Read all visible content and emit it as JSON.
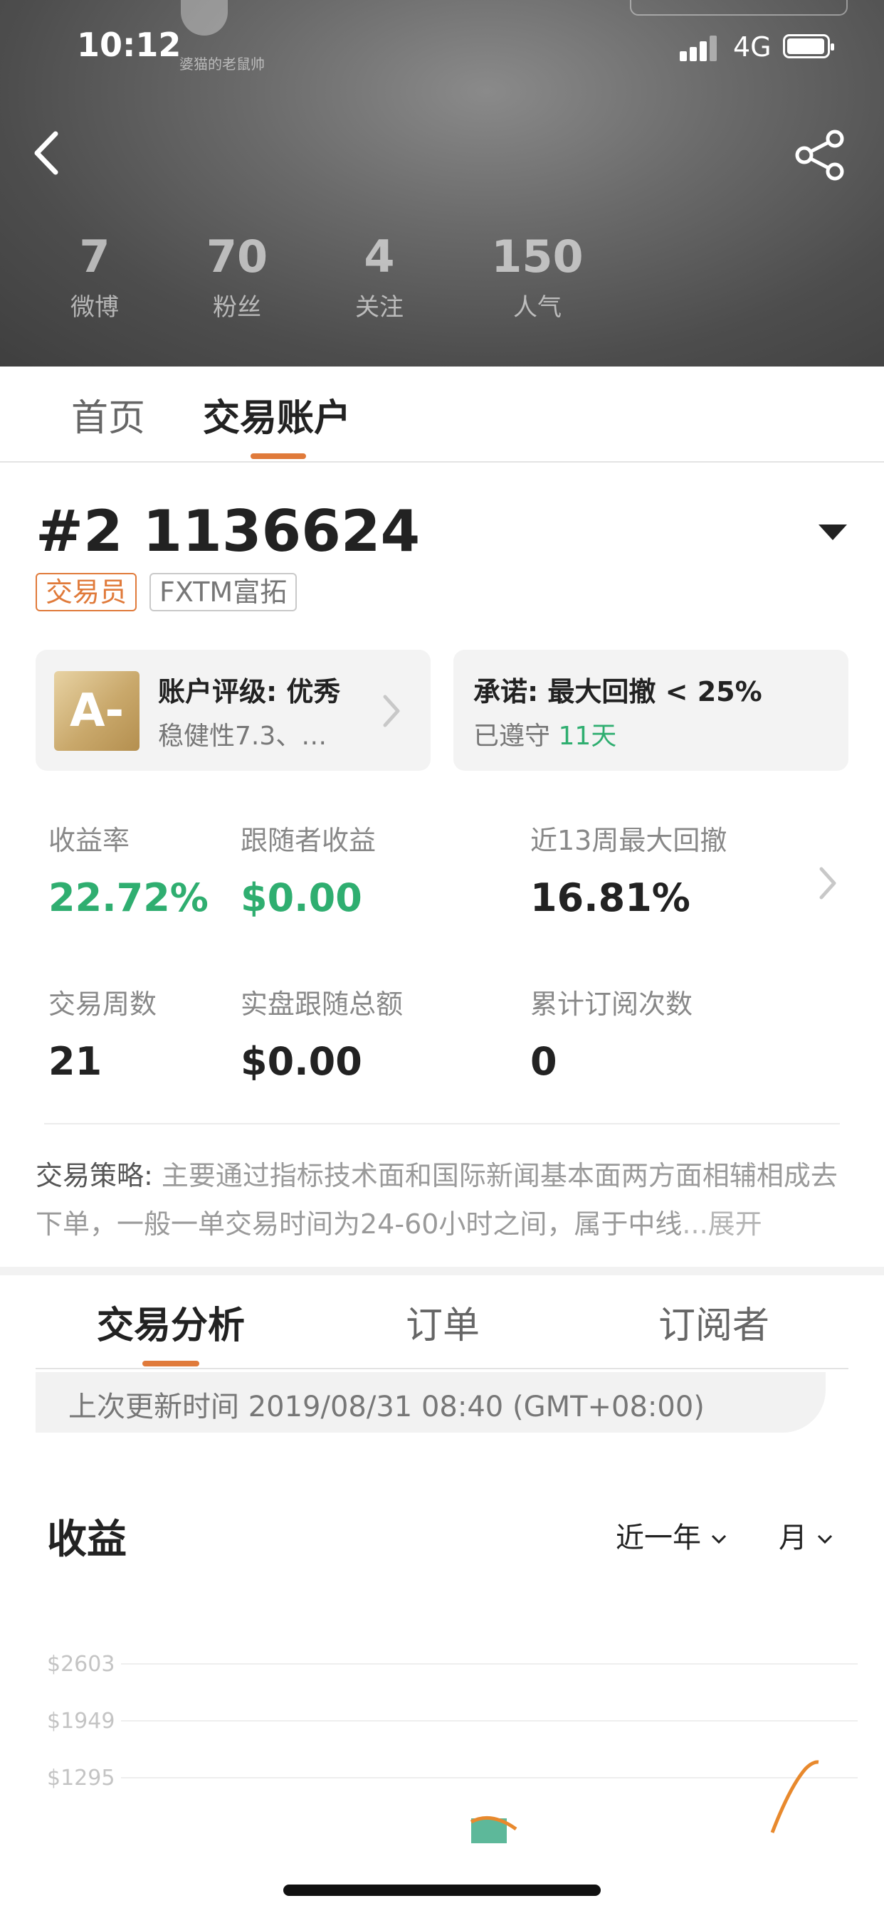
{
  "status_bar": {
    "time": "10:12",
    "network": "4G"
  },
  "watermark": {
    "text": "婆猫的老鼠帅"
  },
  "header": {
    "stats": [
      {
        "value": "7",
        "label": "微博"
      },
      {
        "value": "70",
        "label": "粉丝"
      },
      {
        "value": "4",
        "label": "关注"
      },
      {
        "value": "150",
        "label": "人气"
      }
    ],
    "icons": {
      "back": "back-chevron-icon",
      "share": "share-icon"
    }
  },
  "tabs": [
    {
      "label": "首页"
    },
    {
      "label": "交易账户",
      "active": true
    }
  ],
  "account": {
    "title": "#2 1136624",
    "badges": [
      "交易员",
      "FXTM富拓"
    ],
    "rating_card": {
      "grade": "A-",
      "line1": "账户评级: 优秀",
      "line2": "稳健性7.3、…"
    },
    "promise_card": {
      "line1": "承诺: 最大回撤 < 25%",
      "line2_prefix": "已遵守 ",
      "line2_value": "11天"
    },
    "metrics": [
      {
        "label": "收益率",
        "value": "22.72%",
        "color": "#2fae70"
      },
      {
        "label": "跟随者收益",
        "value": "$0.00",
        "color": "#2fae70"
      },
      {
        "label": "近13周最大回撤",
        "value": "16.81%",
        "color": "#222222"
      },
      {
        "label": "交易周数",
        "value": "21",
        "color": "#222222"
      },
      {
        "label": "实盘跟随总额",
        "value": "$0.00",
        "color": "#222222"
      },
      {
        "label": "累计订阅次数",
        "value": "0",
        "color": "#222222"
      }
    ],
    "strategy": {
      "label": "交易策略: ",
      "text": "主要通过指标技术面和国际新闻基本面两方面相辅相成去下单，一般一单交易时间为24-60小时之间，属于中线",
      "more": "...展开"
    }
  },
  "sub_tabs": [
    {
      "label": "交易分析",
      "active": true
    },
    {
      "label": "订单"
    },
    {
      "label": "订阅者"
    }
  ],
  "update_time": "上次更新时间 2019/08/31 08:40 (GMT+08:00)",
  "chart_section": {
    "title": "收益",
    "range_select": "近一年",
    "period_select": "月"
  },
  "chart_data": {
    "type": "line",
    "title": "收益",
    "y_ticks": [
      "$2603",
      "$1949",
      "$1295"
    ],
    "ylim": [
      1295,
      2603
    ],
    "grid": true,
    "series": [
      {
        "color": "#e8892d",
        "points_visible": "partial"
      }
    ]
  },
  "colors": {
    "accent": "#e07a3a",
    "positive": "#2fae70"
  }
}
